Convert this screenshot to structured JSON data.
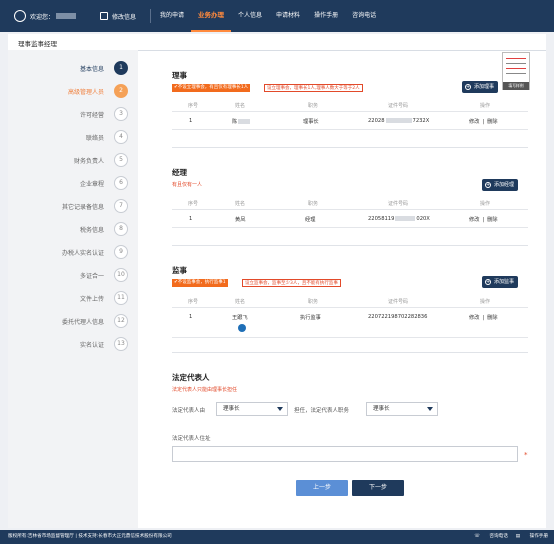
{
  "topbar": {
    "welcome": "欢迎您：",
    "modify": "修改信息",
    "nav": [
      "我的申请",
      "业务办理",
      "个人信息",
      "申请材料",
      "操作手册",
      "咨询电话"
    ],
    "active_index": 1
  },
  "page_title": "理事监事经理",
  "steps": [
    {
      "label": "基本信息",
      "num": "1",
      "state": "done"
    },
    {
      "label": "高级管理人员",
      "num": "2",
      "state": "current"
    },
    {
      "label": "许可经营",
      "num": "3",
      "state": "todo"
    },
    {
      "label": "联络员",
      "num": "4",
      "state": "todo"
    },
    {
      "label": "财务负责人",
      "num": "5",
      "state": "todo"
    },
    {
      "label": "企业章程",
      "num": "6",
      "state": "todo"
    },
    {
      "label": "其它记录备信息",
      "num": "7",
      "state": "todo"
    },
    {
      "label": "税务信息",
      "num": "8",
      "state": "todo"
    },
    {
      "label": "办税人实名认证",
      "num": "9",
      "state": "todo"
    },
    {
      "label": "多证合一",
      "num": "10",
      "state": "todo"
    },
    {
      "label": "文件上传",
      "num": "11",
      "state": "todo"
    },
    {
      "label": "委托代理人信息",
      "num": "12",
      "state": "todo"
    },
    {
      "label": "实名认证",
      "num": "13",
      "state": "todo"
    }
  ],
  "thumb_caption": "填写样例",
  "table_headers": [
    "序号",
    "姓名",
    "职务",
    "证件号码",
    "操作"
  ],
  "ops": {
    "edit": "修改",
    "del": "删除"
  },
  "directors": {
    "title": "理事",
    "tag1": "✔不设立理事会，有且仅有理事长1人",
    "tag2": "设立理事会，理事长1人,理事人数大于等于2人",
    "add": "添加理事",
    "rows": [
      {
        "no": "1",
        "name": "陈",
        "role": "理事长",
        "id_prefix": "22028",
        "id_suffix": "7232X"
      }
    ]
  },
  "manager": {
    "title": "经理",
    "note": "有且仅有一人",
    "add": "添加经理",
    "rows": [
      {
        "no": "1",
        "name": "黄凤",
        "role": "经理",
        "id_prefix": "22058119",
        "id_suffix": "020X"
      }
    ]
  },
  "supervisor": {
    "title": "监事",
    "tag1": "✔不设监事会，执行监事1",
    "tag2": "设立监事会，监事至少3人，且不能有执行监事",
    "add": "添加监事",
    "rows": [
      {
        "no": "1",
        "name": "王跟飞",
        "role": "执行监事",
        "id": "220722198702282836"
      }
    ]
  },
  "legal": {
    "title": "法定代表人",
    "note": "法定代表人只能由理事长担任",
    "by_label": "法定代表人由",
    "by_value": "理事长",
    "mid_label": "担任，法定代表人职务",
    "role_value": "理事长",
    "addr_label": "法定代表人住址",
    "required_mark": "*"
  },
  "buttons": {
    "prev": "上一步",
    "next": "下一步"
  },
  "footer": {
    "left": "版权所有:吉林省市场监督管理厅 | 技术支持:长春市大正元鼎信技术股份有限公司",
    "phone": "咨询电话",
    "manual": "操作手册"
  }
}
